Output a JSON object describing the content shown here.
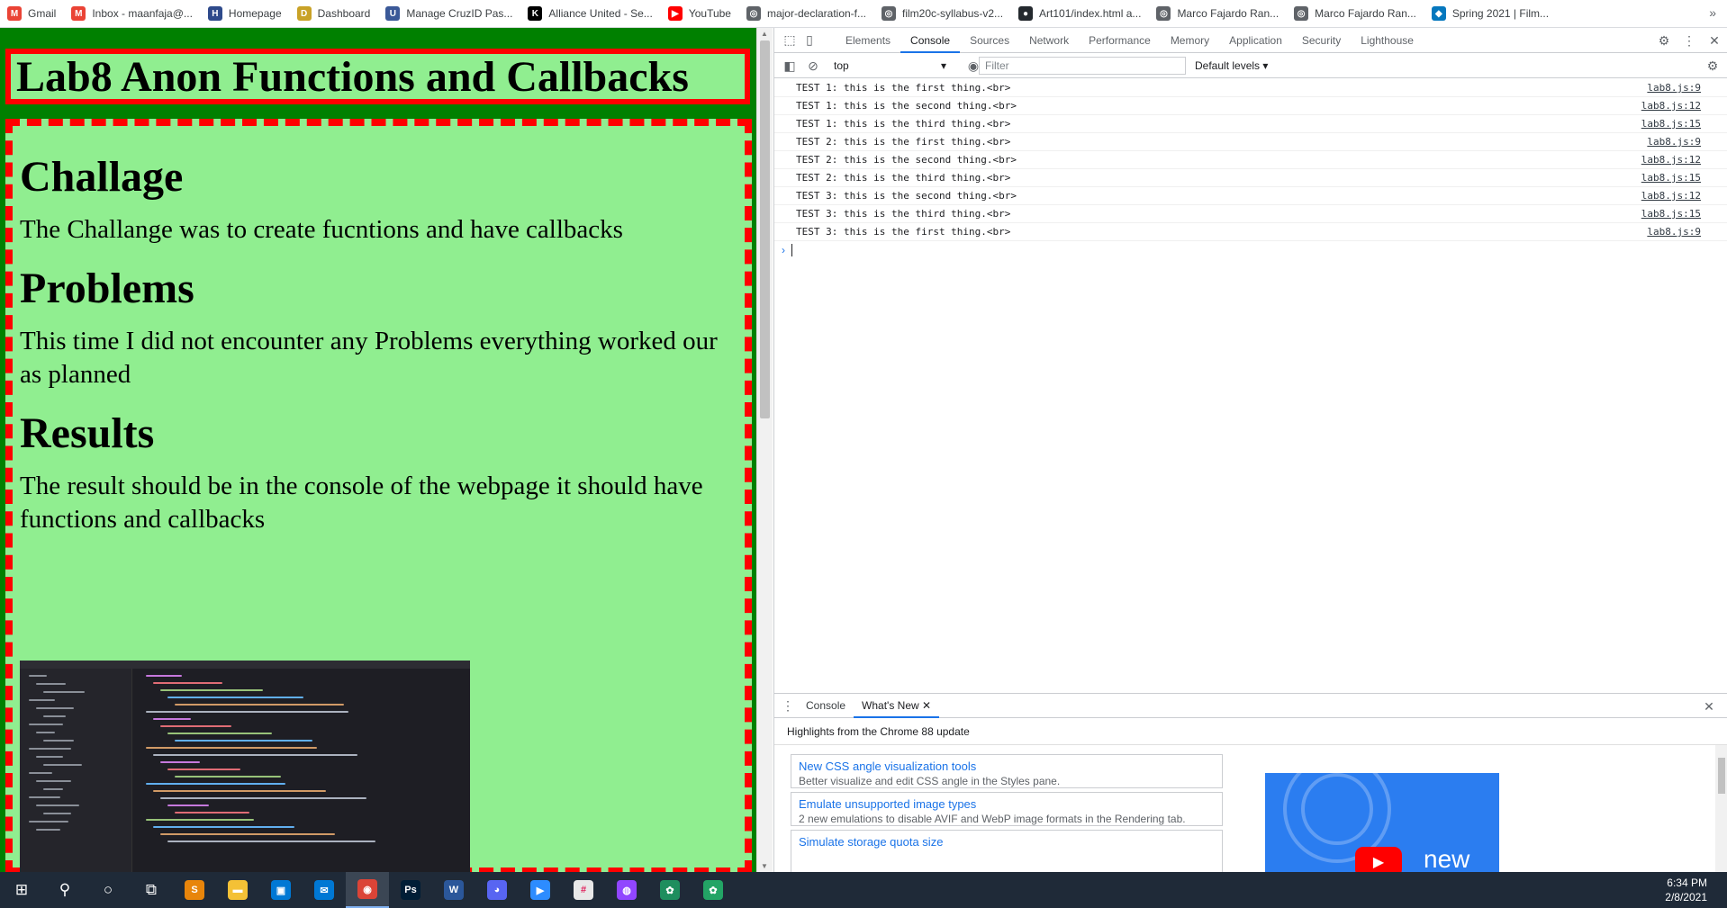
{
  "bookmarks": [
    {
      "label": "Gmail",
      "icon": "gmail-icon",
      "color": "#ea4335",
      "glyph": "M"
    },
    {
      "label": "Inbox - maanfaja@...",
      "icon": "gmail-icon",
      "color": "#ea4335",
      "glyph": "M"
    },
    {
      "label": "Homepage",
      "icon": "page-icon",
      "color": "#2e4a8b",
      "glyph": "H"
    },
    {
      "label": "Dashboard",
      "icon": "dashboard-icon",
      "color": "#c9a227",
      "glyph": "D"
    },
    {
      "label": "Manage CruzID Pas...",
      "icon": "ucsc-icon",
      "color": "#3b5998",
      "glyph": "U"
    },
    {
      "label": "Alliance United - Se...",
      "icon": "k-icon",
      "color": "#000000",
      "glyph": "K"
    },
    {
      "label": "YouTube",
      "icon": "youtube-icon",
      "color": "#ff0000",
      "glyph": "▶"
    },
    {
      "label": "major-declaration-f...",
      "icon": "globe-icon",
      "color": "#5f6368",
      "glyph": "◎"
    },
    {
      "label": "film20c-syllabus-v2...",
      "icon": "globe-icon",
      "color": "#5f6368",
      "glyph": "◎"
    },
    {
      "label": "Art101/index.html a...",
      "icon": "github-icon",
      "color": "#24292e",
      "glyph": "●"
    },
    {
      "label": "Marco Fajardo Ran...",
      "icon": "globe-icon",
      "color": "#5f6368",
      "glyph": "◎"
    },
    {
      "label": "Marco Fajardo Ran...",
      "icon": "globe-icon",
      "color": "#5f6368",
      "glyph": "◎"
    },
    {
      "label": "Spring 2021 | Film...",
      "icon": "drupal-icon",
      "color": "#0678be",
      "glyph": "◆"
    }
  ],
  "page": {
    "title": "Lab8 Anon Functions and Callbacks",
    "sections": [
      {
        "heading": "Challage",
        "text": "The Challange was to create fucntions and have callbacks"
      },
      {
        "heading": "Problems",
        "text": "This time I did not encounter any Problems everything worked our as planned"
      },
      {
        "heading": "Results",
        "text": "The result should be in the console of the webpage it should have functions and callbacks"
      }
    ],
    "colors": {
      "background": "#008000",
      "box": "#90ee90",
      "border": "#ff0000"
    }
  },
  "devtools": {
    "tabs": [
      "Elements",
      "Console",
      "Sources",
      "Network",
      "Performance",
      "Memory",
      "Application",
      "Security",
      "Lighthouse"
    ],
    "active_tab": "Console",
    "context": "top",
    "filter_placeholder": "Filter",
    "levels": "Default levels ▾",
    "log": [
      {
        "text": "TEST 1: this is the first thing.<br>",
        "src": "lab8.js:9"
      },
      {
        "text": "TEST 1: this is the second thing.<br>",
        "src": "lab8.js:12"
      },
      {
        "text": "TEST 1: this is the third thing.<br>",
        "src": "lab8.js:15"
      },
      {
        "text": "TEST 2: this is the first thing.<br>",
        "src": "lab8.js:9"
      },
      {
        "text": "TEST 2: this is the second thing.<br>",
        "src": "lab8.js:12"
      },
      {
        "text": "TEST 2: this is the third thing.<br>",
        "src": "lab8.js:15"
      },
      {
        "text": "TEST 3: this is the second thing.<br>",
        "src": "lab8.js:12"
      },
      {
        "text": "TEST 3: this is the third thing.<br>",
        "src": "lab8.js:15"
      },
      {
        "text": "TEST 3: this is the first thing.<br>",
        "src": "lab8.js:9"
      }
    ],
    "drawer": {
      "tabs": [
        "Console",
        "What's New"
      ],
      "active_tab": "What's New",
      "heading": "Highlights from the Chrome 88 update",
      "cards": [
        {
          "title": "New CSS angle visualization tools",
          "desc": "Better visualize and edit CSS angle in the Styles pane."
        },
        {
          "title": "Emulate unsupported image types",
          "desc": "2 new emulations to disable AVIF and WebP image formats in the Rendering tab."
        },
        {
          "title": "Simulate storage quota size",
          "desc": ""
        }
      ],
      "banner_text": "new"
    }
  },
  "taskbar": {
    "apps": [
      {
        "name": "start-icon",
        "glyph": "⊞",
        "color": "transparent"
      },
      {
        "name": "search-icon",
        "glyph": "⚲",
        "color": "transparent"
      },
      {
        "name": "cortana-icon",
        "glyph": "○",
        "color": "transparent"
      },
      {
        "name": "task-view-icon",
        "glyph": "⧉",
        "color": "transparent"
      },
      {
        "name": "sublime-icon",
        "glyph": "S",
        "color": "#e8850b"
      },
      {
        "name": "file-explorer-icon",
        "glyph": "▬",
        "color": "#f4c136"
      },
      {
        "name": "store-icon",
        "glyph": "▣",
        "color": "#0078d4"
      },
      {
        "name": "mail-icon",
        "glyph": "✉",
        "color": "#0078d4"
      },
      {
        "name": "chrome-icon",
        "glyph": "◉",
        "color": "#db4437"
      },
      {
        "name": "photoshop-icon",
        "glyph": "Ps",
        "color": "#001e36"
      },
      {
        "name": "word-icon",
        "glyph": "W",
        "color": "#2b579a"
      },
      {
        "name": "discord-icon",
        "glyph": "◕",
        "color": "#5865f2"
      },
      {
        "name": "zoom-icon",
        "glyph": "▶",
        "color": "#2d8cff"
      },
      {
        "name": "slack-icon",
        "glyph": "#",
        "color": "#e8e8e8"
      },
      {
        "name": "teams-icon",
        "glyph": "◍",
        "color": "#9146ff"
      },
      {
        "name": "app-icon",
        "glyph": "✿",
        "color": "#1e8e5e"
      },
      {
        "name": "app2-icon",
        "glyph": "✿",
        "color": "#23a465"
      }
    ],
    "time": "6:34 PM",
    "date": "2/8/2021"
  }
}
